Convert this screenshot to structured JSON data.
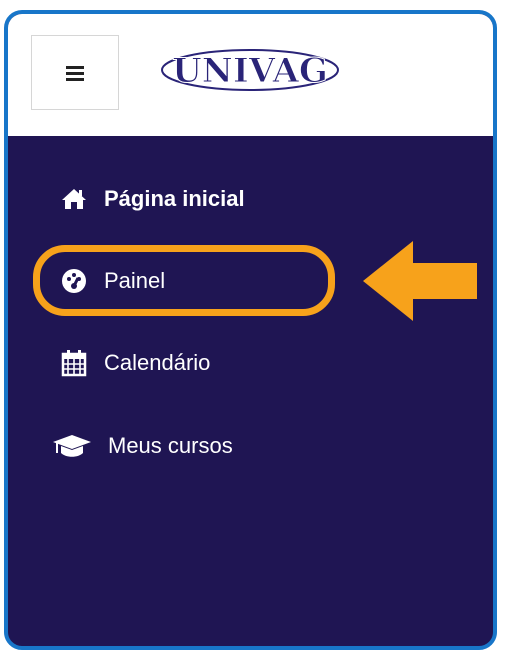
{
  "app": {
    "logo_text": "UNIVAG"
  },
  "header": {
    "menu_icon": "hamburger-icon"
  },
  "nav": {
    "items": [
      {
        "label": "Página inicial",
        "icon": "home-icon"
      },
      {
        "label": "Painel",
        "icon": "dashboard-gauge-icon",
        "highlighted": true
      },
      {
        "label": "Calendário",
        "icon": "calendar-icon"
      },
      {
        "label": "Meus cursos",
        "icon": "graduation-cap-icon"
      }
    ]
  },
  "colors": {
    "frame_border": "#1876c9",
    "sidebar_bg": "#1f1553",
    "highlight": "#f7a21b",
    "logo": "#2a2478"
  }
}
